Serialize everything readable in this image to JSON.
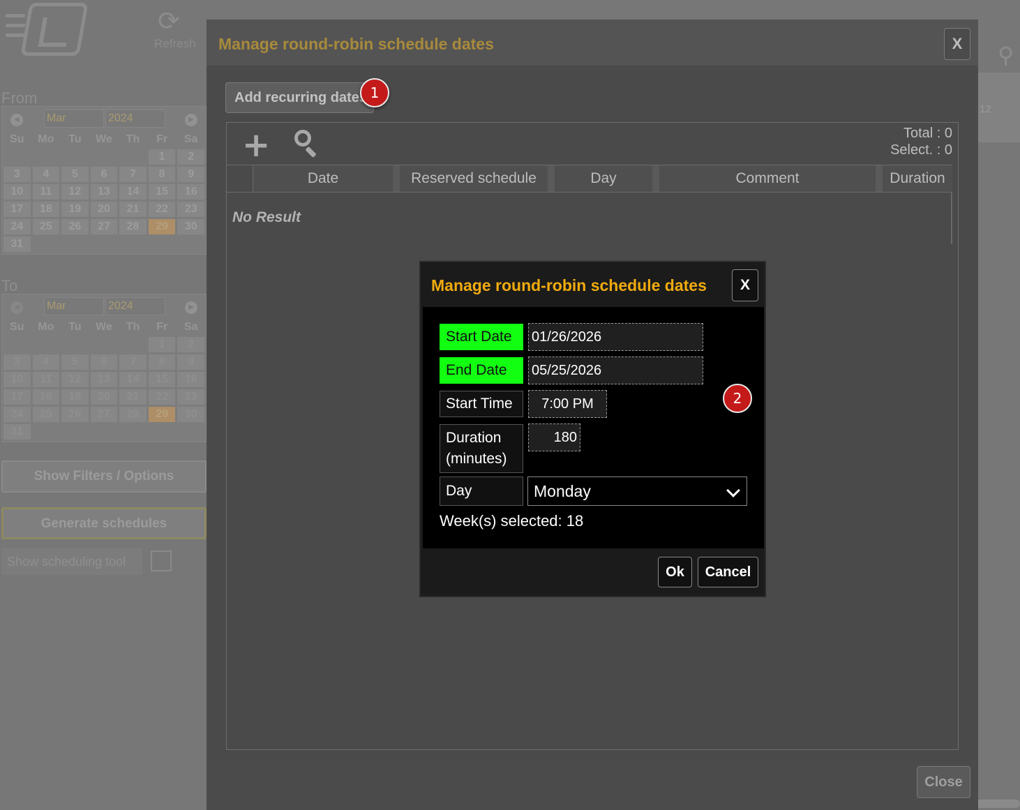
{
  "background": {
    "refresh_label": "Refresh",
    "from_label": "From",
    "to_label": "To",
    "from_calendar": {
      "month": "Mar",
      "year": "2024",
      "weekdays": [
        "Su",
        "Mo",
        "Tu",
        "We",
        "Th",
        "Fr",
        "Sa"
      ],
      "weeks": [
        [
          "",
          "",
          "",
          "",
          "",
          "1",
          "2"
        ],
        [
          "3",
          "4",
          "5",
          "6",
          "7",
          "8",
          "9"
        ],
        [
          "10",
          "11",
          "12",
          "13",
          "14",
          "15",
          "16"
        ],
        [
          "17",
          "18",
          "19",
          "20",
          "21",
          "22",
          "23"
        ],
        [
          "24",
          "25",
          "26",
          "27",
          "28",
          "29",
          "30"
        ],
        [
          "31",
          "",
          "",
          "",
          "",
          "",
          ""
        ]
      ],
      "highlighted_day": "29"
    },
    "to_calendar": {
      "month": "Mar",
      "year": "2024",
      "weekdays": [
        "Su",
        "Mo",
        "Tu",
        "We",
        "Th",
        "Fr",
        "Sa"
      ],
      "weeks": [
        [
          "",
          "",
          "",
          "",
          "",
          "1",
          "2"
        ],
        [
          "3",
          "4",
          "5",
          "6",
          "7",
          "8",
          "9"
        ],
        [
          "10",
          "11",
          "12",
          "13",
          "14",
          "15",
          "16"
        ],
        [
          "17",
          "18",
          "19",
          "20",
          "21",
          "22",
          "23"
        ],
        [
          "24",
          "25",
          "26",
          "27",
          "28",
          "29",
          "30"
        ],
        [
          "31",
          "",
          "",
          "",
          "",
          "",
          ""
        ]
      ],
      "highlighted_day": "29"
    },
    "show_filters_label": "Show Filters / Options",
    "generate_label": "Generate schedules",
    "scheduling_tool_label": "Show scheduling tool",
    "right_number": "12"
  },
  "modal": {
    "title": "Manage round-robin schedule dates",
    "close_label": "X",
    "add_recurring_label": "Add recurring dates",
    "total_text": "Total : 0",
    "select_text": "Select. : 0",
    "columns": [
      "Date",
      "Reserved schedule",
      "Day",
      "Comment",
      "Duration"
    ],
    "no_result": "No Result",
    "footer_close_label": "Close"
  },
  "badges": {
    "one": "1",
    "two": "2"
  },
  "dialog": {
    "title": "Manage round-robin schedule dates",
    "close_label": "X",
    "start_date_label": "Start Date",
    "start_date_value": "01/26/2026",
    "end_date_label": "End Date",
    "end_date_value": "05/25/2026",
    "start_time_label": "Start Time",
    "start_time_value": "7:00 PM",
    "duration_label_1": "Duration",
    "duration_label_2": "(minutes)",
    "duration_value": "180",
    "day_label": "Day",
    "day_value": "Monday",
    "weeks_selected": "Week(s) selected: 18",
    "ok_label": "Ok",
    "cancel_label": "Cancel"
  },
  "colors": {
    "title_gold": "#f0ab0f",
    "required_green": "#12ff12",
    "badge_red": "#c41a1a"
  }
}
